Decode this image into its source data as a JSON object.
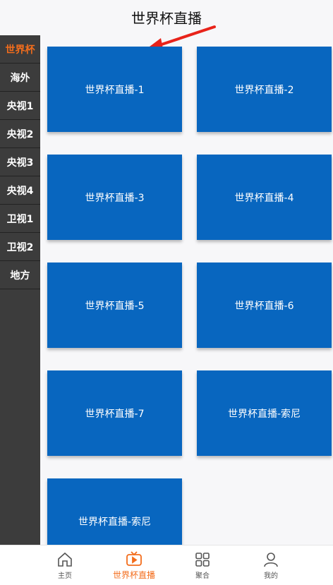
{
  "header": {
    "title": "世界杯直播"
  },
  "sidebar": {
    "items": [
      {
        "label": "世界杯",
        "active": true
      },
      {
        "label": "海外"
      },
      {
        "label": "央视1"
      },
      {
        "label": "央视2"
      },
      {
        "label": "央视3"
      },
      {
        "label": "央视4"
      },
      {
        "label": "卫视1"
      },
      {
        "label": "卫视2"
      },
      {
        "label": "地方"
      }
    ]
  },
  "cards": [
    {
      "label": "世界杯直播-1"
    },
    {
      "label": "世界杯直播-2"
    },
    {
      "label": "世界杯直播-3"
    },
    {
      "label": "世界杯直播-4"
    },
    {
      "label": "世界杯直播-5"
    },
    {
      "label": "世界杯直播-6"
    },
    {
      "label": "世界杯直播-7"
    },
    {
      "label": "世界杯直播-索尼"
    },
    {
      "label": "世界杯直播-索尼"
    }
  ],
  "tabbar": {
    "tabs": [
      {
        "label": "主页",
        "icon": "home-icon"
      },
      {
        "label": "世界杯直播",
        "icon": "tv-icon",
        "active": true
      },
      {
        "label": "聚合",
        "icon": "grid-icon"
      },
      {
        "label": "我的",
        "icon": "user-icon"
      }
    ]
  },
  "colors": {
    "accent": "#f36d1c",
    "card": "#0866bf",
    "sidebar": "#3c3c3c",
    "arrow": "#e8231a"
  }
}
